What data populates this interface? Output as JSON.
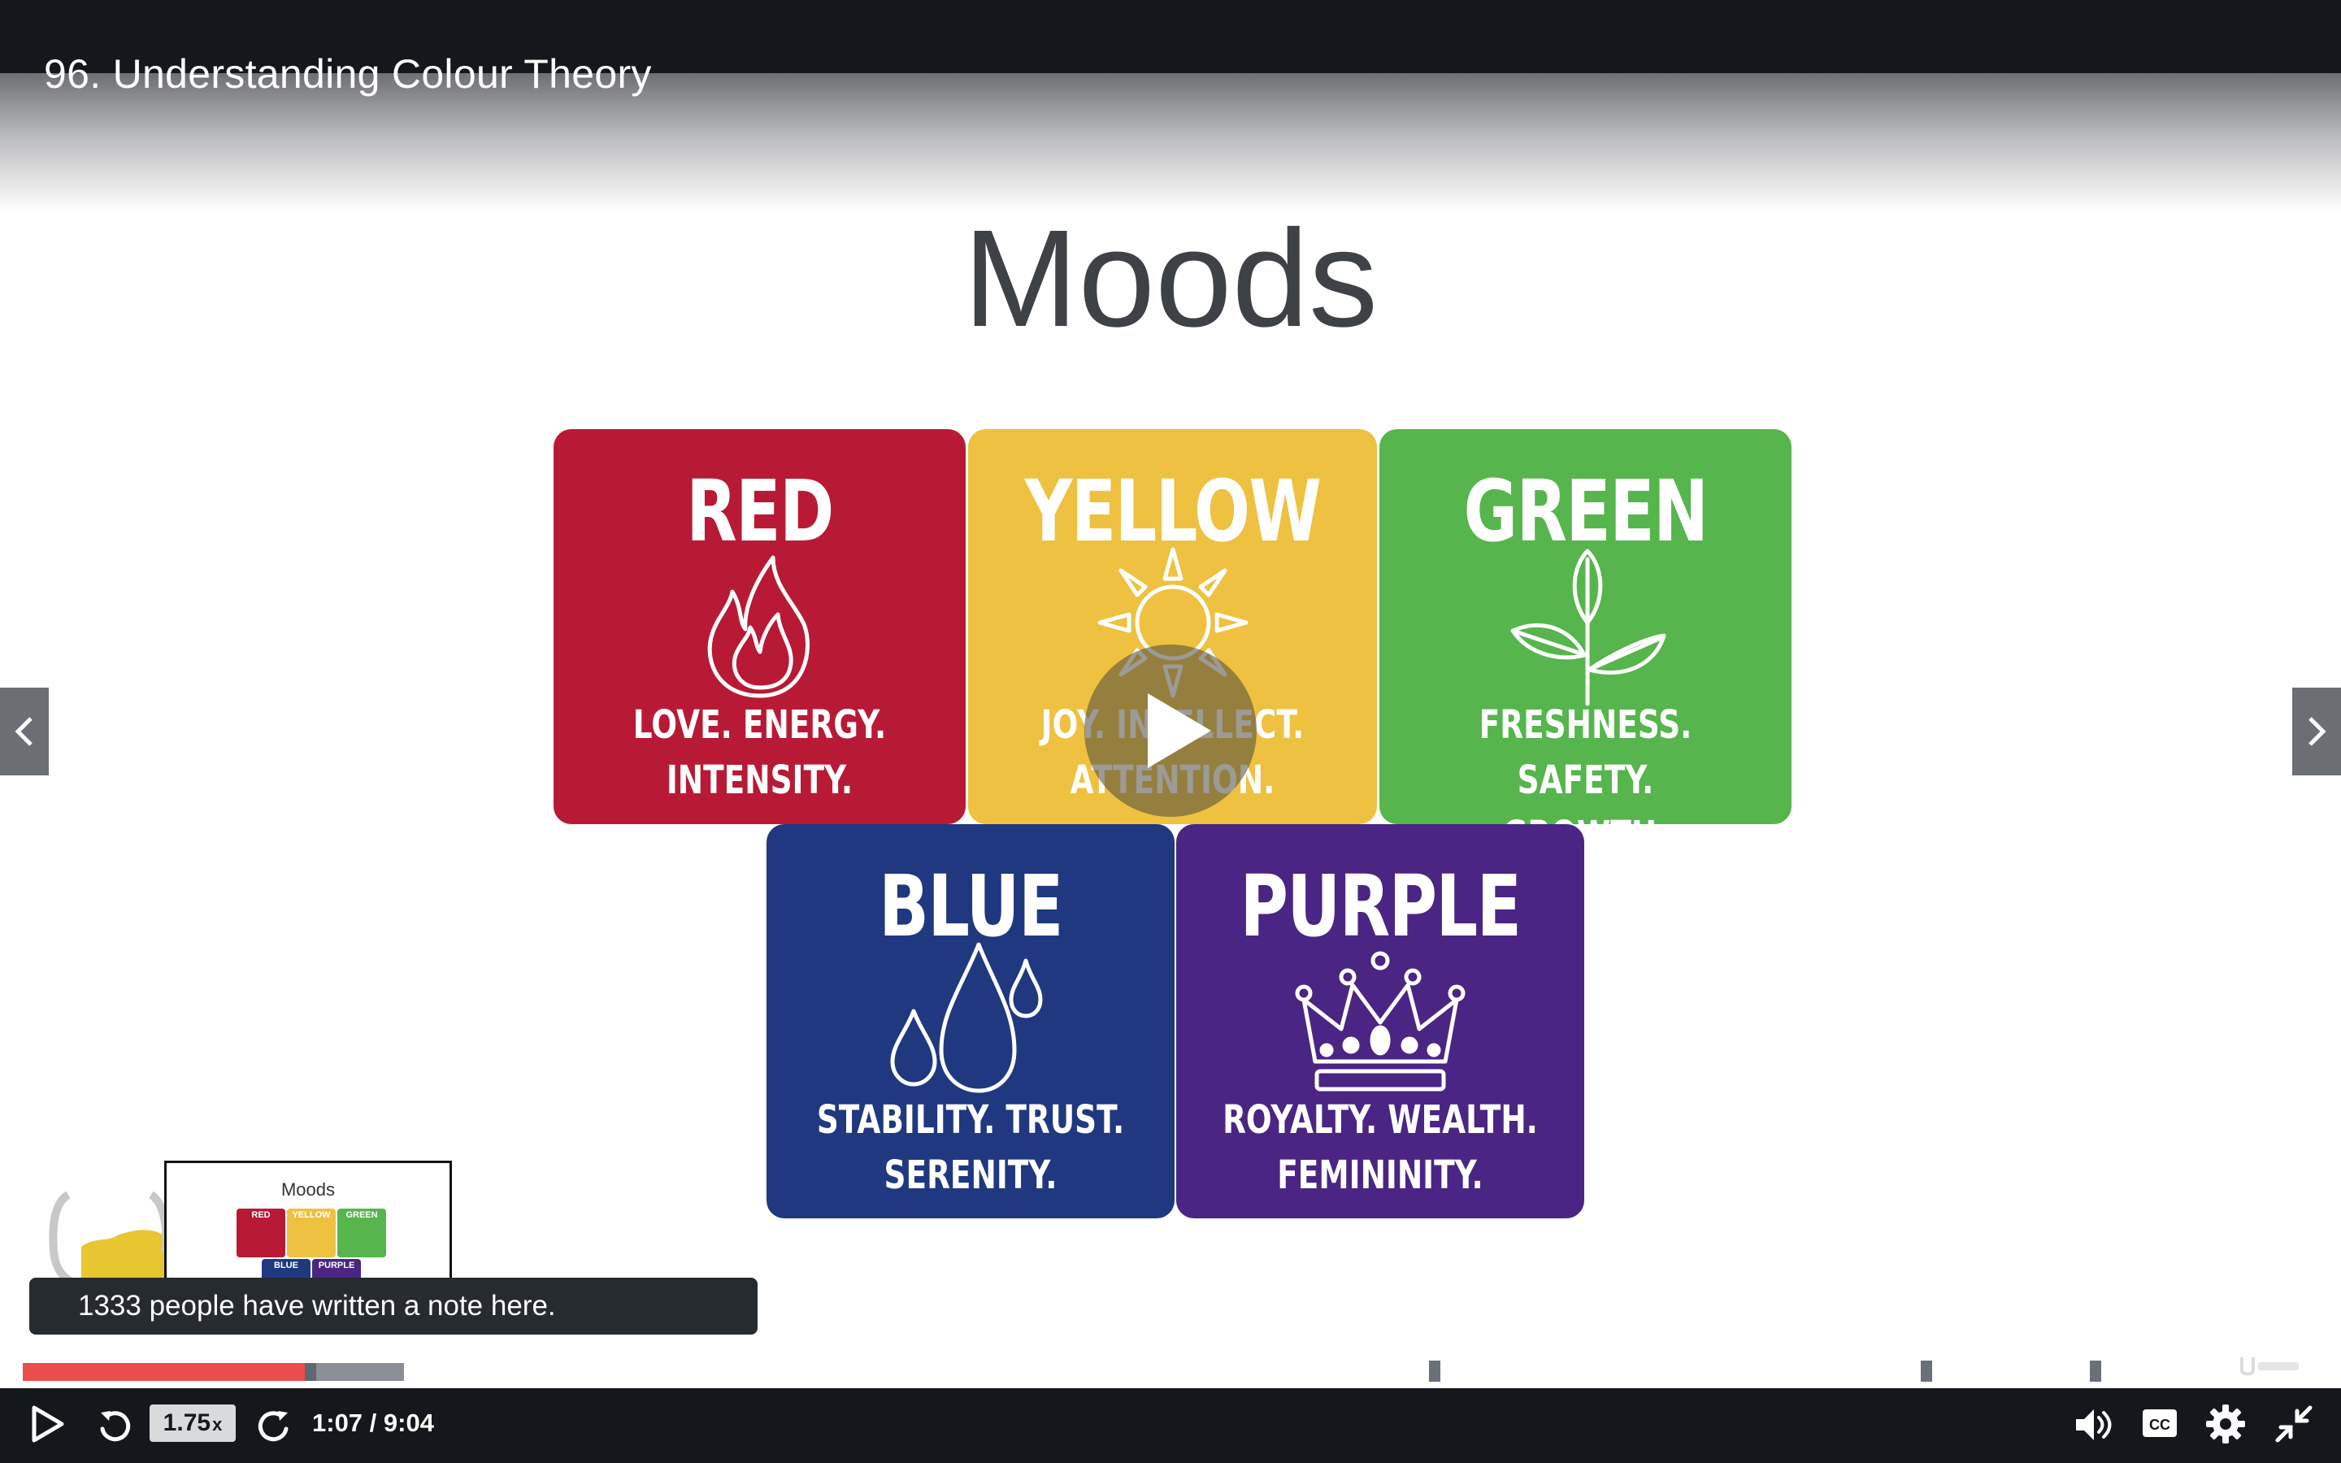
{
  "header": {
    "lecture_title": "96. Understanding Colour Theory"
  },
  "slide": {
    "title": "Moods",
    "cards": [
      {
        "name": "RED",
        "line1": "LOVE. ENERGY.",
        "line2": "INTENSITY.",
        "color": "#b81a36",
        "icon": "flame-icon"
      },
      {
        "name": "YELLOW",
        "line1": "JOY. INTELLECT.",
        "line2": "ATTENTION.",
        "color": "#eec140",
        "icon": "sun-icon"
      },
      {
        "name": "GREEN",
        "line1": "FRESHNESS. SAFETY.",
        "line2": "GROWTH.",
        "color": "#56b54c",
        "icon": "leaves-icon"
      },
      {
        "name": "BLUE",
        "line1": "STABILITY. TRUST.",
        "line2": "SERENITY.",
        "color": "#1f3880",
        "icon": "water-drops-icon"
      },
      {
        "name": "PURPLE",
        "line1": "ROYALTY. WEALTH.",
        "line2": "FEMININITY.",
        "color": "#4a2583",
        "icon": "crown-icon"
      }
    ]
  },
  "thumbnail": {
    "title": "Moods",
    "labels": [
      "RED",
      "YELLOW",
      "GREEN",
      "BLUE",
      "PURPLE"
    ]
  },
  "note_tooltip": {
    "text": "1333 people have written a note here."
  },
  "player": {
    "played_fraction": 0.123,
    "buffered_fraction": 0.166,
    "speed": "1.75",
    "speed_suffix": "x",
    "time": "1:07 / 9:04",
    "accent_color": "#ea4d4c"
  }
}
